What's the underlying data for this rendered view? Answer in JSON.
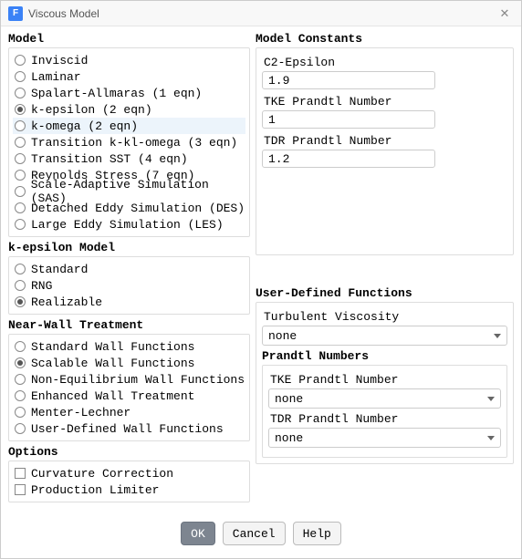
{
  "window": {
    "title": "Viscous Model",
    "icon_letter": "F"
  },
  "model": {
    "title": "Model",
    "options": [
      "Inviscid",
      "Laminar",
      "Spalart-Allmaras (1 eqn)",
      "k-epsilon (2 eqn)",
      "k-omega (2 eqn)",
      "Transition k-kl-omega (3 eqn)",
      "Transition SST (4 eqn)",
      "Reynolds Stress (7 eqn)",
      "Scale-Adaptive Simulation (SAS)",
      "Detached Eddy Simulation (DES)",
      "Large Eddy Simulation (LES)"
    ],
    "selected_index": 3,
    "highlight_index": 4
  },
  "kepsilon": {
    "title": "k-epsilon Model",
    "options": [
      "Standard",
      "RNG",
      "Realizable"
    ],
    "selected_index": 2
  },
  "nearwall": {
    "title": "Near-Wall Treatment",
    "options": [
      "Standard Wall Functions",
      "Scalable Wall Functions",
      "Non-Equilibrium Wall Functions",
      "Enhanced Wall Treatment",
      "Menter-Lechner",
      "User-Defined Wall Functions"
    ],
    "selected_index": 1
  },
  "options": {
    "title": "Options",
    "items": [
      "Curvature Correction",
      "Production Limiter"
    ]
  },
  "constants": {
    "title": "Model Constants",
    "fields": [
      {
        "label": "C2-Epsilon",
        "value": "1.9"
      },
      {
        "label": "TKE Prandtl Number",
        "value": "1"
      },
      {
        "label": "TDR Prandtl Number",
        "value": "1.2"
      }
    ]
  },
  "udf": {
    "title": "User-Defined Functions",
    "turbvisc_label": "Turbulent Viscosity",
    "turbvisc_value": "none",
    "prandtl_title": "Prandtl Numbers",
    "prandtl_fields": [
      {
        "label": "TKE Prandtl Number",
        "value": "none"
      },
      {
        "label": "TDR Prandtl Number",
        "value": "none"
      }
    ]
  },
  "buttons": {
    "ok": "OK",
    "cancel": "Cancel",
    "help": "Help"
  }
}
